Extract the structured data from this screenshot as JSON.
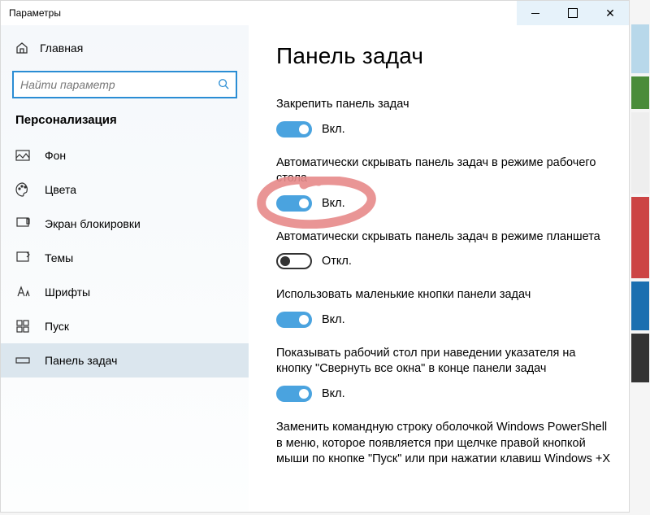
{
  "window": {
    "title": "Параметры"
  },
  "sidebar": {
    "home": "Главная",
    "search_placeholder": "Найти параметр",
    "category": "Персонализация",
    "items": [
      {
        "label": "Фон"
      },
      {
        "label": "Цвета"
      },
      {
        "label": "Экран блокировки"
      },
      {
        "label": "Темы"
      },
      {
        "label": "Шрифты"
      },
      {
        "label": "Пуск"
      },
      {
        "label": "Панель задач"
      }
    ]
  },
  "main": {
    "heading": "Панель задач",
    "settings": [
      {
        "label": "Закрепить панель задач",
        "state": "on",
        "state_text": "Вкл."
      },
      {
        "label": "Автоматически скрывать панель задач в режиме рабочего стола",
        "state": "on",
        "state_text": "Вкл."
      },
      {
        "label": "Автоматически скрывать панель задач в режиме планшета",
        "state": "off",
        "state_text": "Откл."
      },
      {
        "label": "Использовать маленькие кнопки панели задач",
        "state": "on",
        "state_text": "Вкл."
      },
      {
        "label": "Показывать рабочий стол при наведении указателя на кнопку \"Свернуть все окна\" в конце панели задач",
        "state": "on",
        "state_text": "Вкл."
      },
      {
        "label": "Заменить командную строку оболочкой Windows PowerShell в меню, которое появляется при щелчке правой кнопкой мыши по кнопке \"Пуск\" или при нажатии клавиш Windows +X",
        "state": "",
        "state_text": ""
      }
    ]
  }
}
